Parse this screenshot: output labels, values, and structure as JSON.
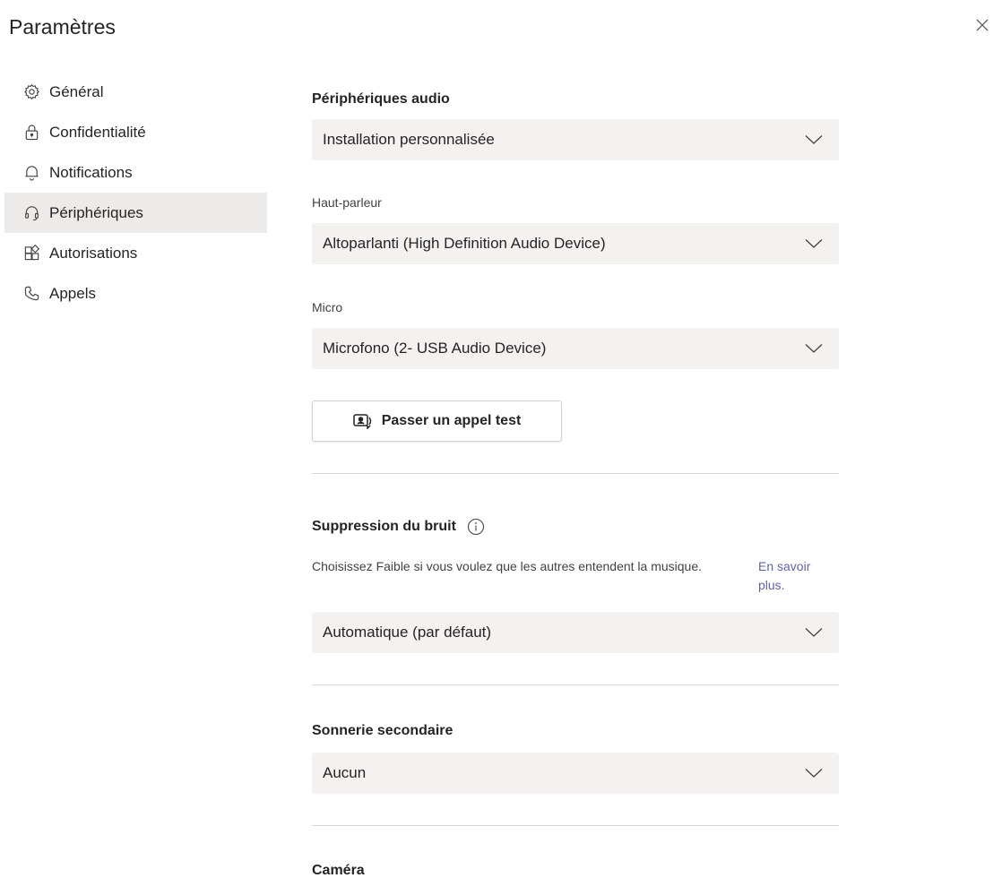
{
  "window": {
    "title": "Paramètres"
  },
  "sidebar": {
    "items": [
      {
        "label": "Général",
        "icon": "gear-icon",
        "active": false
      },
      {
        "label": "Confidentialité",
        "icon": "lock-icon",
        "active": false
      },
      {
        "label": "Notifications",
        "icon": "bell-icon",
        "active": false
      },
      {
        "label": "Périphériques",
        "icon": "headset-icon",
        "active": true
      },
      {
        "label": "Autorisations",
        "icon": "apps-icon",
        "active": false
      },
      {
        "label": "Appels",
        "icon": "phone-icon",
        "active": false
      }
    ]
  },
  "audio": {
    "title": "Périphériques audio",
    "device_setup": "Installation personnalisée",
    "speaker_label": "Haut-parleur",
    "speaker_value": "Altoparlanti (High Definition Audio Device)",
    "mic_label": "Micro",
    "mic_value": "Microfono (2- USB Audio Device)",
    "test_call_label": "Passer un appel test"
  },
  "noise": {
    "title": "Suppression du bruit",
    "description": "Choisissez Faible si vous voulez que les autres entendent la musique.",
    "learn_more": "En savoir plus.",
    "value": "Automatique (par défaut)"
  },
  "ringer": {
    "title": "Sonnerie secondaire",
    "value": "Aucun"
  },
  "camera": {
    "title": "Caméra"
  },
  "colors": {
    "accent": "#6264a7",
    "active_bg": "#edebe9",
    "dropdown_bg": "#f3f2f1"
  }
}
